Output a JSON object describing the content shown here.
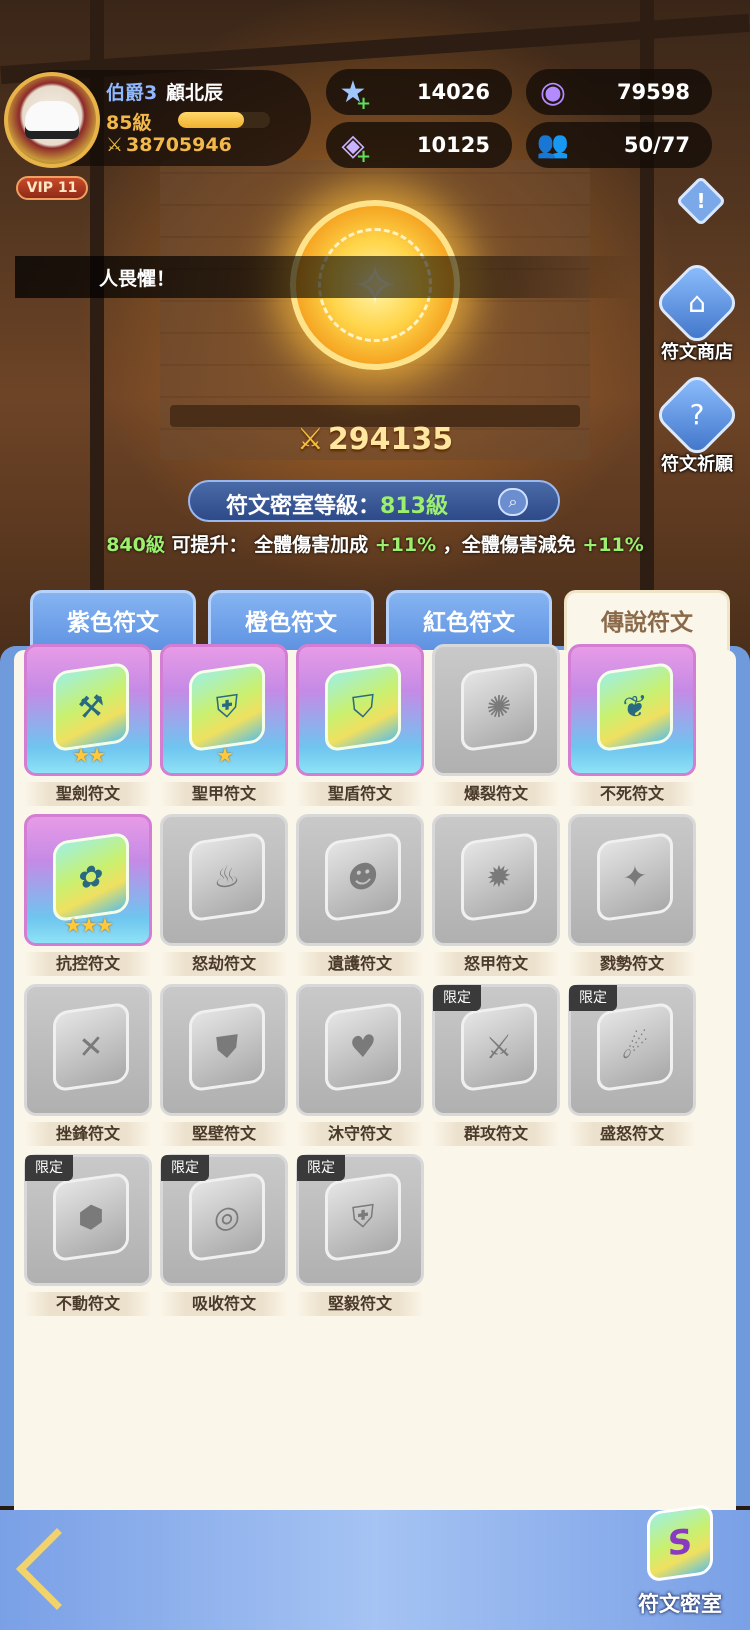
{
  "player": {
    "rank": "伯爵3",
    "name": "顧北辰",
    "level": "85級",
    "xp_progress": 0.72,
    "power": "38705946",
    "vip": "VIP 11"
  },
  "resources": {
    "stars": {
      "value": "14026",
      "icon": "star-crystal-icon"
    },
    "gems": {
      "value": "79598",
      "icon": "purple-orb-icon"
    },
    "cubes": {
      "value": "10125",
      "icon": "cube-crystal-icon"
    },
    "members": {
      "value": "50/77",
      "icon": "people-icon"
    }
  },
  "speech": "人畏懼！",
  "side_buttons": {
    "shop": "符文商店",
    "pray": "符文祈願"
  },
  "chamber": {
    "power": "294135",
    "label": "符文密室等級：",
    "level": "813級",
    "upgrade_level": "840級",
    "upgrade_text_1": " 可提升： 全體傷害加成 ",
    "upgrade_val_1": "+11%",
    "upgrade_text_2": " ，全體傷害減免 ",
    "upgrade_val_2": "+11%"
  },
  "tabs": [
    "紫色符文",
    "橙色符文",
    "紅色符文",
    "傳說符文"
  ],
  "active_tab": 3,
  "limited_label": "限定",
  "runes": [
    {
      "name": "聖劍符文",
      "owned": true,
      "stars": "★★",
      "icon": "axe-icon",
      "glyph": "⚒",
      "limited": false
    },
    {
      "name": "聖甲符文",
      "owned": true,
      "stars": "★",
      "icon": "armor-icon",
      "glyph": "⛨",
      "limited": false
    },
    {
      "name": "聖盾符文",
      "owned": true,
      "stars": "",
      "icon": "shield-icon",
      "glyph": "⛉",
      "limited": false
    },
    {
      "name": "爆裂符文",
      "owned": false,
      "stars": "",
      "icon": "explosion-icon",
      "glyph": "✺",
      "limited": false
    },
    {
      "name": "不死符文",
      "owned": true,
      "stars": "",
      "icon": "wings-icon",
      "glyph": "❦",
      "limited": false
    },
    {
      "name": "抗控符文",
      "owned": true,
      "stars": "★★★",
      "icon": "shield-flower-icon",
      "glyph": "✿",
      "limited": false
    },
    {
      "name": "怒劫符文",
      "owned": false,
      "stars": "",
      "icon": "flame-icon",
      "glyph": "♨",
      "limited": false
    },
    {
      "name": "遺護符文",
      "owned": false,
      "stars": "",
      "icon": "head-icon",
      "glyph": "☻",
      "limited": false
    },
    {
      "name": "怒甲符文",
      "owned": false,
      "stars": "",
      "icon": "fire-armor-icon",
      "glyph": "✹",
      "limited": false
    },
    {
      "name": "戮勢符文",
      "owned": false,
      "stars": "",
      "icon": "blade-icon",
      "glyph": "✦",
      "limited": false
    },
    {
      "name": "挫鋒符文",
      "owned": false,
      "stars": "",
      "icon": "broken-sword-icon",
      "glyph": "✕",
      "limited": false
    },
    {
      "name": "堅壁符文",
      "owned": false,
      "stars": "",
      "icon": "wall-shield-icon",
      "glyph": "⛊",
      "limited": false
    },
    {
      "name": "沐守符文",
      "owned": false,
      "stars": "",
      "icon": "heart-icon",
      "glyph": "♥",
      "limited": false
    },
    {
      "name": "群攻符文",
      "owned": false,
      "stars": "",
      "icon": "triple-sword-icon",
      "glyph": "⚔",
      "limited": true
    },
    {
      "name": "盛怒符文",
      "owned": false,
      "stars": "",
      "icon": "rage-icon",
      "glyph": "☄",
      "limited": true
    },
    {
      "name": "不動符文",
      "owned": false,
      "stars": "",
      "icon": "fortress-icon",
      "glyph": "⬢",
      "limited": true
    },
    {
      "name": "吸收符文",
      "owned": false,
      "stars": "",
      "icon": "vortex-icon",
      "glyph": "◎",
      "limited": true
    },
    {
      "name": "堅毅符文",
      "owned": false,
      "stars": "",
      "icon": "crest-icon",
      "glyph": "⛨",
      "limited": true
    }
  ],
  "bottom": {
    "chamber_label": "符文密室",
    "back_icon": "back-arrow-icon"
  }
}
